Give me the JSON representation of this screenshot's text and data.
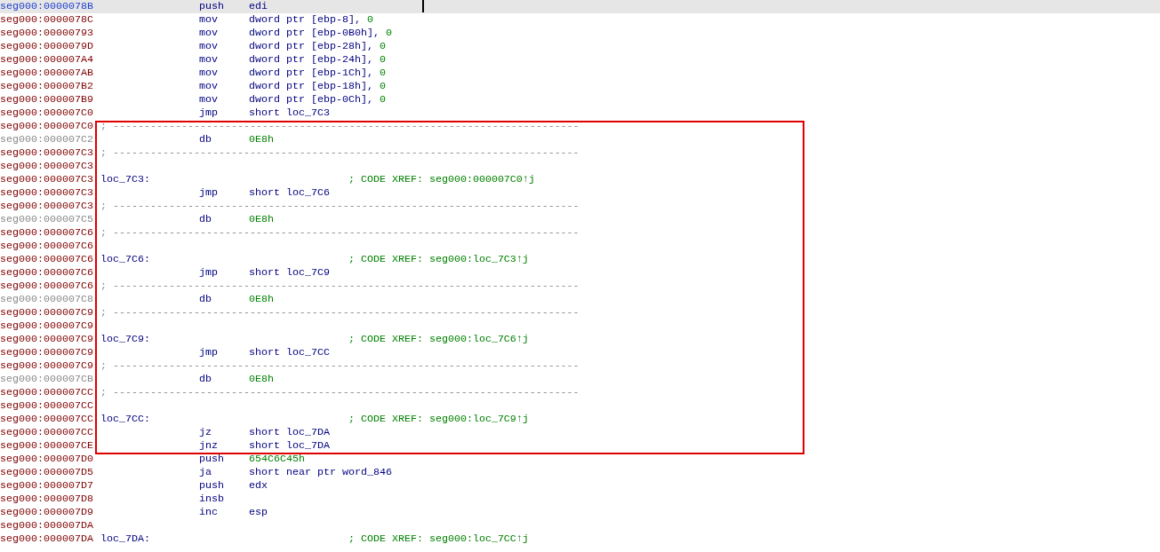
{
  "listing": {
    "rows_before": [
      {
        "address": "seg000:0000078B",
        "kind": "code",
        "mnemonic": "push",
        "operand": "edi",
        "selected": true
      },
      {
        "address": "seg000:0000078C",
        "kind": "code",
        "mnemonic": "mov",
        "operand": "dword ptr [ebp-8], ",
        "value": "0",
        "selected": false
      },
      {
        "address": "seg000:00000793",
        "kind": "code",
        "mnemonic": "mov",
        "operand": "dword ptr [ebp-0B0h], ",
        "value": "0",
        "selected": false
      },
      {
        "address": "seg000:0000079D",
        "kind": "code",
        "mnemonic": "mov",
        "operand": "dword ptr [ebp-28h], ",
        "value": "0",
        "selected": false
      },
      {
        "address": "seg000:000007A4",
        "kind": "code",
        "mnemonic": "mov",
        "operand": "dword ptr [ebp-24h], ",
        "value": "0",
        "selected": false
      },
      {
        "address": "seg000:000007AB",
        "kind": "code",
        "mnemonic": "mov",
        "operand": "dword ptr [ebp-1Ch], ",
        "value": "0",
        "selected": false
      },
      {
        "address": "seg000:000007B2",
        "kind": "code",
        "mnemonic": "mov",
        "operand": "dword ptr [ebp-18h], ",
        "value": "0",
        "selected": false
      },
      {
        "address": "seg000:000007B9",
        "kind": "code",
        "mnemonic": "mov",
        "operand": "dword ptr [ebp-0Ch], ",
        "value": "0",
        "selected": false
      },
      {
        "address": "seg000:000007C0",
        "kind": "code",
        "mnemonic": "jmp",
        "operand": "short loc_7C3",
        "selected": false
      }
    ],
    "highlighted_block": {
      "rows": [
        {
          "address": "seg000:000007C0",
          "kind": "separator",
          "text": "; ---------------------------------------------------------------------------",
          "selected": false
        },
        {
          "address": "seg000:000007C2",
          "kind": "data",
          "mnemonic": "db",
          "value": "0E8h",
          "selected": false
        },
        {
          "address": "seg000:000007C3",
          "kind": "separator",
          "text": "; ---------------------------------------------------------------------------",
          "selected": false
        },
        {
          "address": "seg000:000007C3",
          "kind": "blank",
          "selected": false
        },
        {
          "address": "seg000:000007C3",
          "kind": "label",
          "label": "loc_7C3:",
          "comment": "; CODE XREF: seg000:000007C0↑j",
          "selected": false
        },
        {
          "address": "seg000:000007C3",
          "kind": "code",
          "mnemonic": "jmp",
          "operand": "short loc_7C6",
          "selected": false
        },
        {
          "address": "seg000:000007C3",
          "kind": "separator",
          "text": "; ---------------------------------------------------------------------------",
          "selected": false
        },
        {
          "address": "seg000:000007C5",
          "kind": "data",
          "mnemonic": "db",
          "value": "0E8h",
          "selected": false
        },
        {
          "address": "seg000:000007C6",
          "kind": "separator",
          "text": "; ---------------------------------------------------------------------------",
          "selected": false
        },
        {
          "address": "seg000:000007C6",
          "kind": "blank",
          "selected": false
        },
        {
          "address": "seg000:000007C6",
          "kind": "label",
          "label": "loc_7C6:",
          "comment": "; CODE XREF: seg000:loc_7C3↑j",
          "selected": false
        },
        {
          "address": "seg000:000007C6",
          "kind": "code",
          "mnemonic": "jmp",
          "operand": "short loc_7C9",
          "selected": false
        },
        {
          "address": "seg000:000007C6",
          "kind": "separator",
          "text": "; ---------------------------------------------------------------------------",
          "selected": false
        },
        {
          "address": "seg000:000007C8",
          "kind": "data",
          "mnemonic": "db",
          "value": "0E8h",
          "selected": false
        },
        {
          "address": "seg000:000007C9",
          "kind": "separator",
          "text": "; ---------------------------------------------------------------------------",
          "selected": false
        },
        {
          "address": "seg000:000007C9",
          "kind": "blank",
          "selected": false
        },
        {
          "address": "seg000:000007C9",
          "kind": "label",
          "label": "loc_7C9:",
          "comment": "; CODE XREF: seg000:loc_7C6↑j",
          "selected": false
        },
        {
          "address": "seg000:000007C9",
          "kind": "code",
          "mnemonic": "jmp",
          "operand": "short loc_7CC",
          "selected": false
        },
        {
          "address": "seg000:000007C9",
          "kind": "separator",
          "text": "; ---------------------------------------------------------------------------",
          "selected": false
        },
        {
          "address": "seg000:000007CB",
          "kind": "data",
          "mnemonic": "db",
          "value": "0E8h",
          "selected": false
        },
        {
          "address": "seg000:000007CC",
          "kind": "separator",
          "text": "; ---------------------------------------------------------------------------",
          "selected": false
        },
        {
          "address": "seg000:000007CC",
          "kind": "blank",
          "selected": false
        },
        {
          "address": "seg000:000007CC",
          "kind": "label",
          "label": "loc_7CC:",
          "comment": "; CODE XREF: seg000:loc_7C9↑j",
          "selected": false
        },
        {
          "address": "seg000:000007CC",
          "kind": "code",
          "mnemonic": "jz",
          "operand": "short loc_7DA",
          "selected": false
        },
        {
          "address": "seg000:000007CE",
          "kind": "code",
          "mnemonic": "jnz",
          "operand": "short loc_7DA",
          "selected": false
        }
      ]
    },
    "rows_after": [
      {
        "address": "seg000:000007D0",
        "kind": "code",
        "mnemonic": "push",
        "value": "654C6C45h",
        "selected": false
      },
      {
        "address": "seg000:000007D5",
        "kind": "code",
        "mnemonic": "ja",
        "operand": "short near ptr word_846",
        "selected": false
      },
      {
        "address": "seg000:000007D7",
        "kind": "code",
        "mnemonic": "push",
        "operand": "edx",
        "selected": false
      },
      {
        "address": "seg000:000007D8",
        "kind": "code",
        "mnemonic": "insb",
        "selected": false
      },
      {
        "address": "seg000:000007D9",
        "kind": "code",
        "mnemonic": "inc",
        "operand": "esp",
        "selected": false
      },
      {
        "address": "seg000:000007DA",
        "kind": "blank",
        "selected": false
      },
      {
        "address": "seg000:000007DA",
        "kind": "label",
        "label": "loc_7DA:",
        "comment": "; CODE XREF: seg000:loc_7CC↑j",
        "selected": false
      }
    ]
  }
}
